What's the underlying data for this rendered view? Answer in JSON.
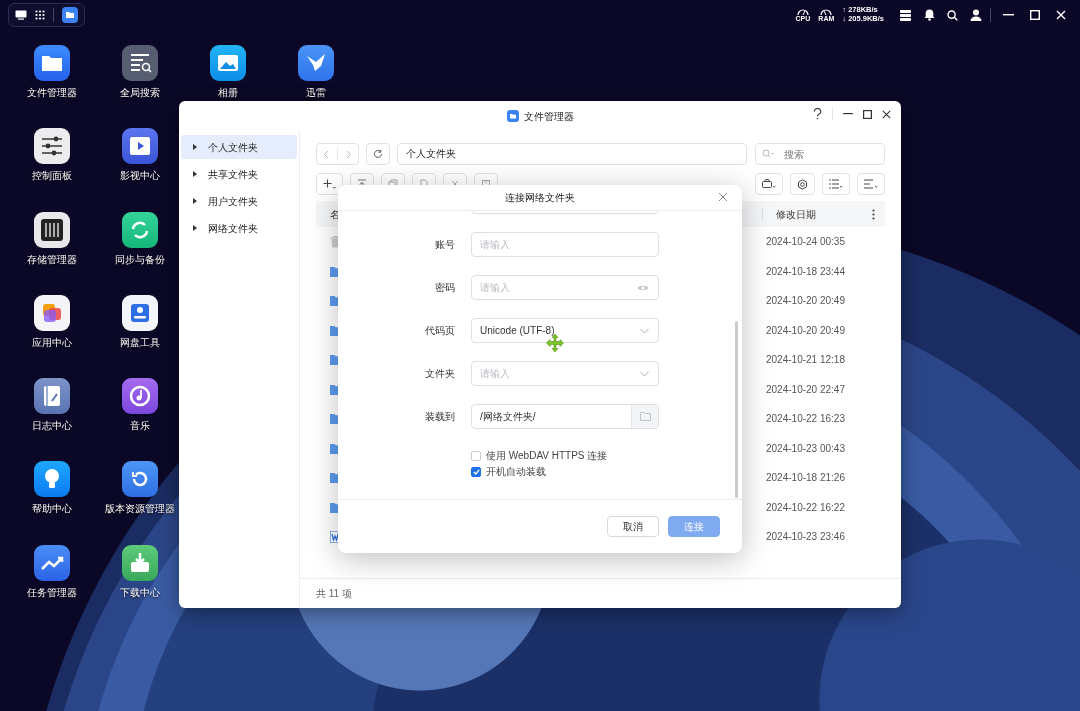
{
  "top_bar": {
    "cpu_label": "CPU",
    "ram_label": "RAM",
    "upload_speed": "↑ 278KB/s",
    "download_speed": "↓ 205.9KB/s"
  },
  "desktop_icons": [
    {
      "label": "文件管理器"
    },
    {
      "label": "控制面板"
    },
    {
      "label": "存储管理器"
    },
    {
      "label": "应用中心"
    },
    {
      "label": "日志中心"
    },
    {
      "label": "帮助中心"
    },
    {
      "label": "任务管理器"
    },
    {
      "label": "全局搜索"
    },
    {
      "label": "影视中心"
    },
    {
      "label": "同步与备份"
    },
    {
      "label": "网盘工具"
    },
    {
      "label": "音乐"
    },
    {
      "label": "版本资源管理器"
    },
    {
      "label": "下载中心"
    },
    {
      "label": "相册"
    },
    {
      "label": "迅雷"
    }
  ],
  "window": {
    "title": "文件管理器",
    "sidebar": [
      {
        "label": "个人文件夹",
        "selected": true
      },
      {
        "label": "共享文件夹",
        "selected": false
      },
      {
        "label": "用户文件夹",
        "selected": false
      },
      {
        "label": "网络文件夹",
        "selected": false
      }
    ],
    "path": "个人文件夹",
    "search": {
      "placeholder": "搜索"
    },
    "table": {
      "columns": [
        "名",
        "修改日期"
      ],
      "rows": [
        {
          "kind": "trash",
          "modified": "2024-10-24 00:35"
        },
        {
          "kind": "folder",
          "modified": "2024-10-18 23:44"
        },
        {
          "kind": "folder",
          "modified": "2024-10-20 20:49"
        },
        {
          "kind": "folder",
          "modified": "2024-10-20 20:49"
        },
        {
          "kind": "folder",
          "modified": "2024-10-21 12:18"
        },
        {
          "kind": "folder",
          "modified": "2024-10-20 22:47"
        },
        {
          "kind": "folder",
          "modified": "2024-10-22 16:23"
        },
        {
          "kind": "folder",
          "modified": "2024-10-23 00:43"
        },
        {
          "kind": "folder",
          "modified": "2024-10-18 21:26"
        },
        {
          "kind": "folder",
          "modified": "2024-10-22 16:22"
        },
        {
          "kind": "word",
          "modified": "2024-10-23 23:46"
        }
      ]
    },
    "status": "共 11 项"
  },
  "dialog": {
    "title": "连接网络文件夹",
    "fields": [
      {
        "label": "账号",
        "kind": "text",
        "placeholder": "请输入"
      },
      {
        "label": "密码",
        "kind": "password",
        "placeholder": "请输入"
      },
      {
        "label": "代码页",
        "kind": "select",
        "value": "Unicode (UTF-8)"
      },
      {
        "label": "文件夹",
        "kind": "select",
        "placeholder": "请输入"
      },
      {
        "label": "装载到",
        "kind": "folder",
        "value": "/网络文件夹/"
      }
    ],
    "options": [
      {
        "label": "使用 WebDAV HTTPS 连接",
        "checked": false
      },
      {
        "label": "开机自动装载",
        "checked": true
      }
    ],
    "buttons": [
      {
        "label": "取消",
        "kind": "secondary",
        "disabled": false
      },
      {
        "label": "连接",
        "kind": "primary",
        "disabled": true
      }
    ]
  }
}
